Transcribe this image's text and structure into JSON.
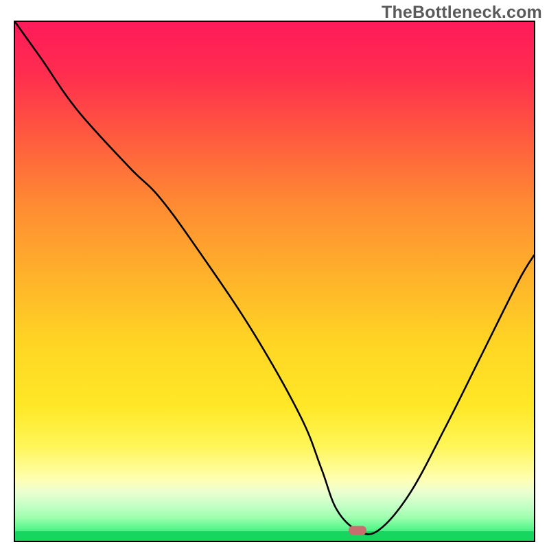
{
  "watermark": "TheBottleneck.com",
  "chart_data": {
    "type": "line",
    "title": "",
    "xlabel": "",
    "ylabel": "",
    "xlim": [
      0,
      100
    ],
    "ylim": [
      0,
      100
    ],
    "grid": false,
    "legend": null,
    "annotations": [],
    "background_gradient_notes": "vertical gradient top→bottom: magenta-red → orange → yellow → pale-yellow → pale-green band near bottom; thin bright green band at very bottom",
    "curve_minimum_x_approx": 65,
    "marker": {
      "x_approx": 66,
      "y_approx": 2,
      "color": "#c76f6f"
    },
    "series": [
      {
        "name": "bottleneck_curve",
        "type": "line",
        "x": [
          0,
          5,
          12,
          22,
          28,
          36,
          46,
          55,
          59,
          62,
          66,
          70,
          76,
          83,
          90,
          97,
          100
        ],
        "values": [
          100,
          93,
          83,
          72,
          66,
          55,
          40,
          24,
          14,
          6,
          2,
          2,
          9,
          22,
          36,
          50,
          55
        ]
      }
    ]
  }
}
